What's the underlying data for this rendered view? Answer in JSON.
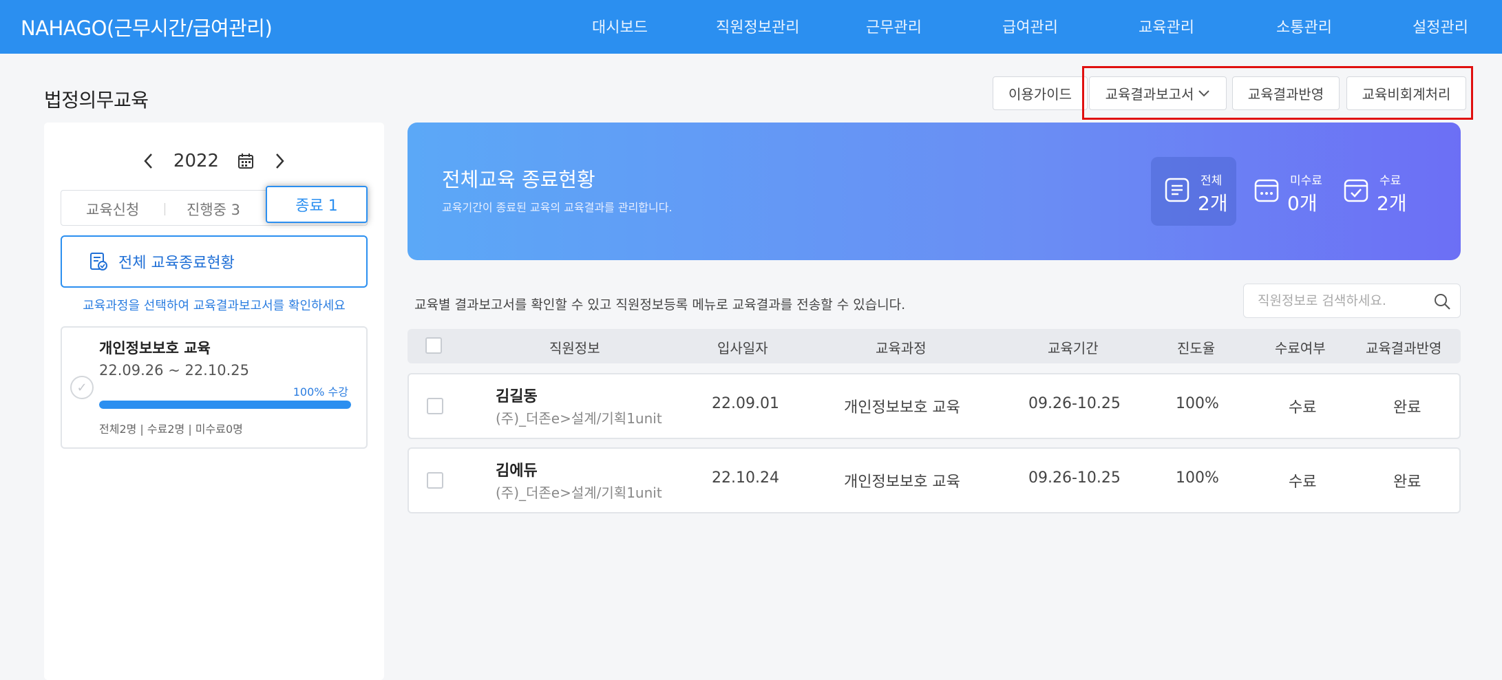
{
  "app": {
    "brand": "NAHAGO(근무시간/급여관리)"
  },
  "nav": [
    "대시보드",
    "직원정보관리",
    "근무관리",
    "급여관리",
    "교육관리",
    "소통관리",
    "설정관리"
  ],
  "page": {
    "title": "법정의무교육"
  },
  "toolbar": {
    "guide": "이용가이드",
    "report": "교육결과보고서",
    "apply": "교육결과반영",
    "nonpaid": "교육비회계처리"
  },
  "sidebar": {
    "year": "2022",
    "tabs": {
      "apply": "교육신청",
      "ongoing": "진행중 3",
      "done": "종료 1"
    },
    "all_status": "전체 교육종료현황",
    "hint": "교육과정을 선택하여 교육결과보고서를 확인하세요",
    "course": {
      "name": "개인정보보호 교육",
      "dates": "22.09.26 ~ 22.10.25",
      "progress_label": "100% 수강",
      "progress": 1.0,
      "counts": "전체2명 | 수료2명 | 미수료0명"
    }
  },
  "banner": {
    "title": "전체교육 종료현황",
    "subtitle": "교육기간이 종료된 교육의 교육결과를 관리합니다.",
    "stats": [
      {
        "label": "전체",
        "value": "2개",
        "icon": "document-list-icon"
      },
      {
        "label": "미수료",
        "value": "0개",
        "icon": "calendar-pending-icon"
      },
      {
        "label": "수료",
        "value": "2개",
        "icon": "calendar-check-icon"
      }
    ]
  },
  "main": {
    "description": "교육별 결과보고서를 확인할 수 있고 직원정보등록 메뉴로 교육결과를 전송할 수 있습니다.",
    "search_placeholder": "직원정보로 검색하세요.",
    "columns": [
      "직원정보",
      "입사일자",
      "교육과정",
      "교육기간",
      "진도율",
      "수료여부",
      "교육결과반영"
    ],
    "rows": [
      {
        "name": "김길동",
        "dept": "(주)_더존e>설계/기획1unit",
        "hire": "22.09.01",
        "course": "개인정보보호 교육",
        "period": "09.26-10.25",
        "progress": "100%",
        "status": "수료",
        "result": "완료"
      },
      {
        "name": "김에듀",
        "dept": "(주)_더존e>설계/기획1unit",
        "hire": "22.10.24",
        "course": "개인정보보호 교육",
        "period": "09.26-10.25",
        "progress": "100%",
        "status": "수료",
        "result": "완료"
      }
    ]
  },
  "colors": {
    "accent": "#2b8ff0",
    "highlight": "#e01010"
  }
}
